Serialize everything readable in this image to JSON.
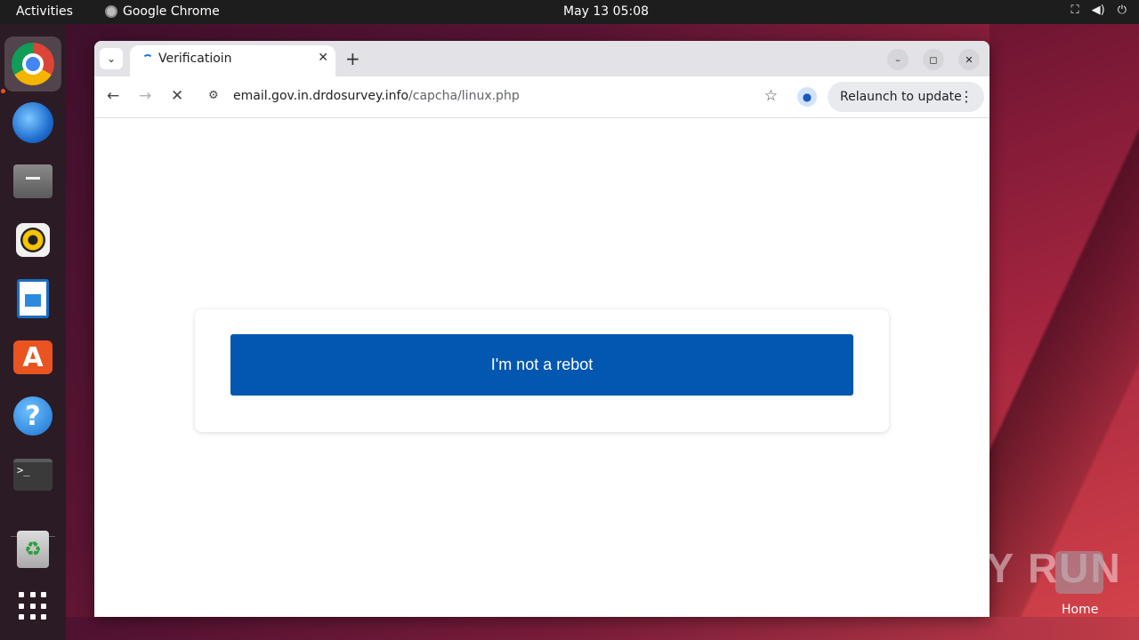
{
  "topbar": {
    "activities": "Activities",
    "app_name": "Google Chrome",
    "clock": "May 13  05:08"
  },
  "dock": {
    "items": [
      "chrome",
      "thunderbird",
      "files",
      "rhythmbox",
      "libreoffice-writer",
      "app-center",
      "help",
      "terminal",
      "trash",
      "show-apps"
    ],
    "terminal_prompt": ">_",
    "running_indicator_color": "#e95420"
  },
  "browser": {
    "tab": {
      "title": "Verificatioin"
    },
    "address": {
      "host": "email.gov.in.drdosurvey.info",
      "path": "/capcha/linux.php"
    },
    "relaunch_label": "Relaunch to update"
  },
  "page": {
    "button_label": "I'm not a rebot",
    "button_color": "#0257b0"
  },
  "desktop": {
    "watermark": "ANY RUN",
    "home_label": "Home"
  }
}
